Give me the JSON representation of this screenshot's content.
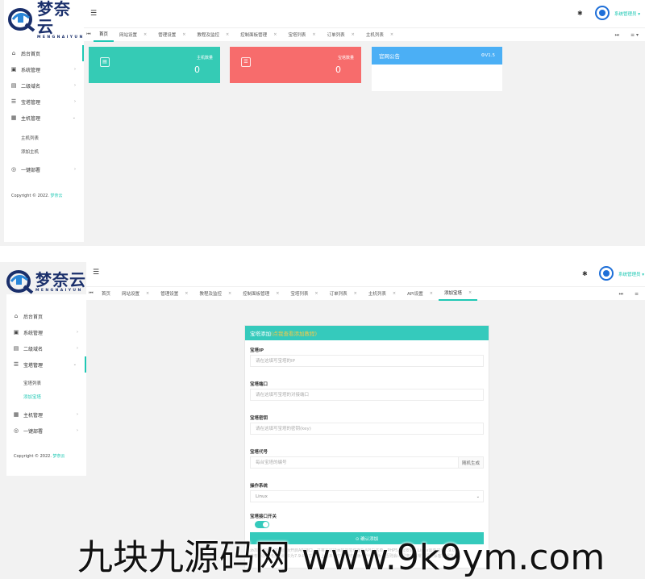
{
  "brand": {
    "name": "梦奈云",
    "slogan": "MENGNAIYUN",
    "accent": "#1fc8b4",
    "logo_blue": "#1a2f6b"
  },
  "top": {
    "menu_icon": "hamburger-icon",
    "theme_icon": "palette-icon",
    "user": "系统管理员",
    "user_caret": "▾"
  },
  "screen1": {
    "sidebar": {
      "items": [
        {
          "icon": "⌂",
          "label": "后台首页",
          "arrow": ""
        },
        {
          "icon": "▣",
          "label": "系统管理",
          "arrow": "›"
        },
        {
          "icon": "▤",
          "label": "二级域名",
          "arrow": "›"
        },
        {
          "icon": "☰",
          "label": "宝塔管理",
          "arrow": "›"
        },
        {
          "icon": "▦",
          "label": "主机管理",
          "arrow": "⌄"
        }
      ],
      "sub_items": [
        "主机列表",
        "添加主机"
      ],
      "after_items": [
        {
          "icon": "◎",
          "label": "一键部署",
          "arrow": "›"
        }
      ],
      "copyright_prefix": "Copyright © 2022.",
      "copyright_brand": "梦奈云"
    },
    "tabs": [
      {
        "label": "首页",
        "close": ""
      },
      {
        "label": "网站设置",
        "close": "×"
      },
      {
        "label": "管理设置",
        "close": "×"
      },
      {
        "label": "教程及监控",
        "close": "×"
      },
      {
        "label": "控制面板管理",
        "close": "×"
      },
      {
        "label": "宝塔列表",
        "close": "×"
      },
      {
        "label": "订单列表",
        "close": "×"
      },
      {
        "label": "主机列表",
        "close": "×"
      }
    ],
    "stats": [
      {
        "label": "主机数量",
        "value": "0",
        "color": "#35cbb5",
        "icon": "server-icon"
      },
      {
        "label": "宝塔数量",
        "value": "0",
        "color": "#f76c6c",
        "icon": "list-icon"
      }
    ],
    "notice": {
      "title": "官网公告",
      "version": "V1.5"
    }
  },
  "screen2": {
    "sidebar": {
      "items": [
        {
          "icon": "⌂",
          "label": "后台首页",
          "arrow": ""
        },
        {
          "icon": "▣",
          "label": "系统管理",
          "arrow": "›"
        },
        {
          "icon": "▤",
          "label": "二级域名",
          "arrow": "›"
        },
        {
          "icon": "☰",
          "label": "宝塔管理",
          "arrow": "⌄"
        }
      ],
      "sub_items": [
        "宝塔列表",
        "添加宝塔"
      ],
      "after_items": [
        {
          "icon": "▦",
          "label": "主机管理",
          "arrow": "›"
        },
        {
          "icon": "◎",
          "label": "一键部署",
          "arrow": "›"
        }
      ],
      "copyright_prefix": "Copyright © 2022.",
      "copyright_brand": "梦奈云"
    },
    "tabs": [
      {
        "label": "首页",
        "close": ""
      },
      {
        "label": "网站设置",
        "close": "×"
      },
      {
        "label": "管理设置",
        "close": "×"
      },
      {
        "label": "教程及监控",
        "close": "×"
      },
      {
        "label": "控制面板管理",
        "close": "×"
      },
      {
        "label": "宝塔列表",
        "close": "×"
      },
      {
        "label": "订单列表",
        "close": "×"
      },
      {
        "label": "主机列表",
        "close": "×"
      },
      {
        "label": "API设置",
        "close": "×"
      },
      {
        "label": "添加宝塔",
        "close": "×"
      }
    ],
    "form": {
      "title": "宝塔添加",
      "title_link": "(点我查看添加教程)",
      "fields": [
        {
          "label": "宝塔IP",
          "placeholder": "请在这填写宝塔的IP"
        },
        {
          "label": "宝塔端口",
          "placeholder": "请在这填写宝塔的对接端口"
        },
        {
          "label": "宝塔密钥",
          "placeholder": "请在这填写宝塔的密钥(key)"
        }
      ],
      "code_label": "宝塔代号",
      "code_placeholder": "每台宝塔的编号",
      "code_button": "随机生成",
      "os_label": "操作系统",
      "os_value": "Linux",
      "switch_label": "宝塔接口开关",
      "submit": "⊙ 确认添加",
      "tips": [
        "添加宝塔需在宝塔面板开启API接口，并将本站IP添加到宝塔面板API白名单，PHP5.6需安装，Linux需要宝塔7.9.0",
        "推荐添加宝塔面板版本为7.9.0左右，以上版本请勿在宝塔面板中升级面板，否则会出现接口异常，请联系客服解决"
      ]
    }
  },
  "watermark": "九块九源码网 www.9k9ym.com"
}
